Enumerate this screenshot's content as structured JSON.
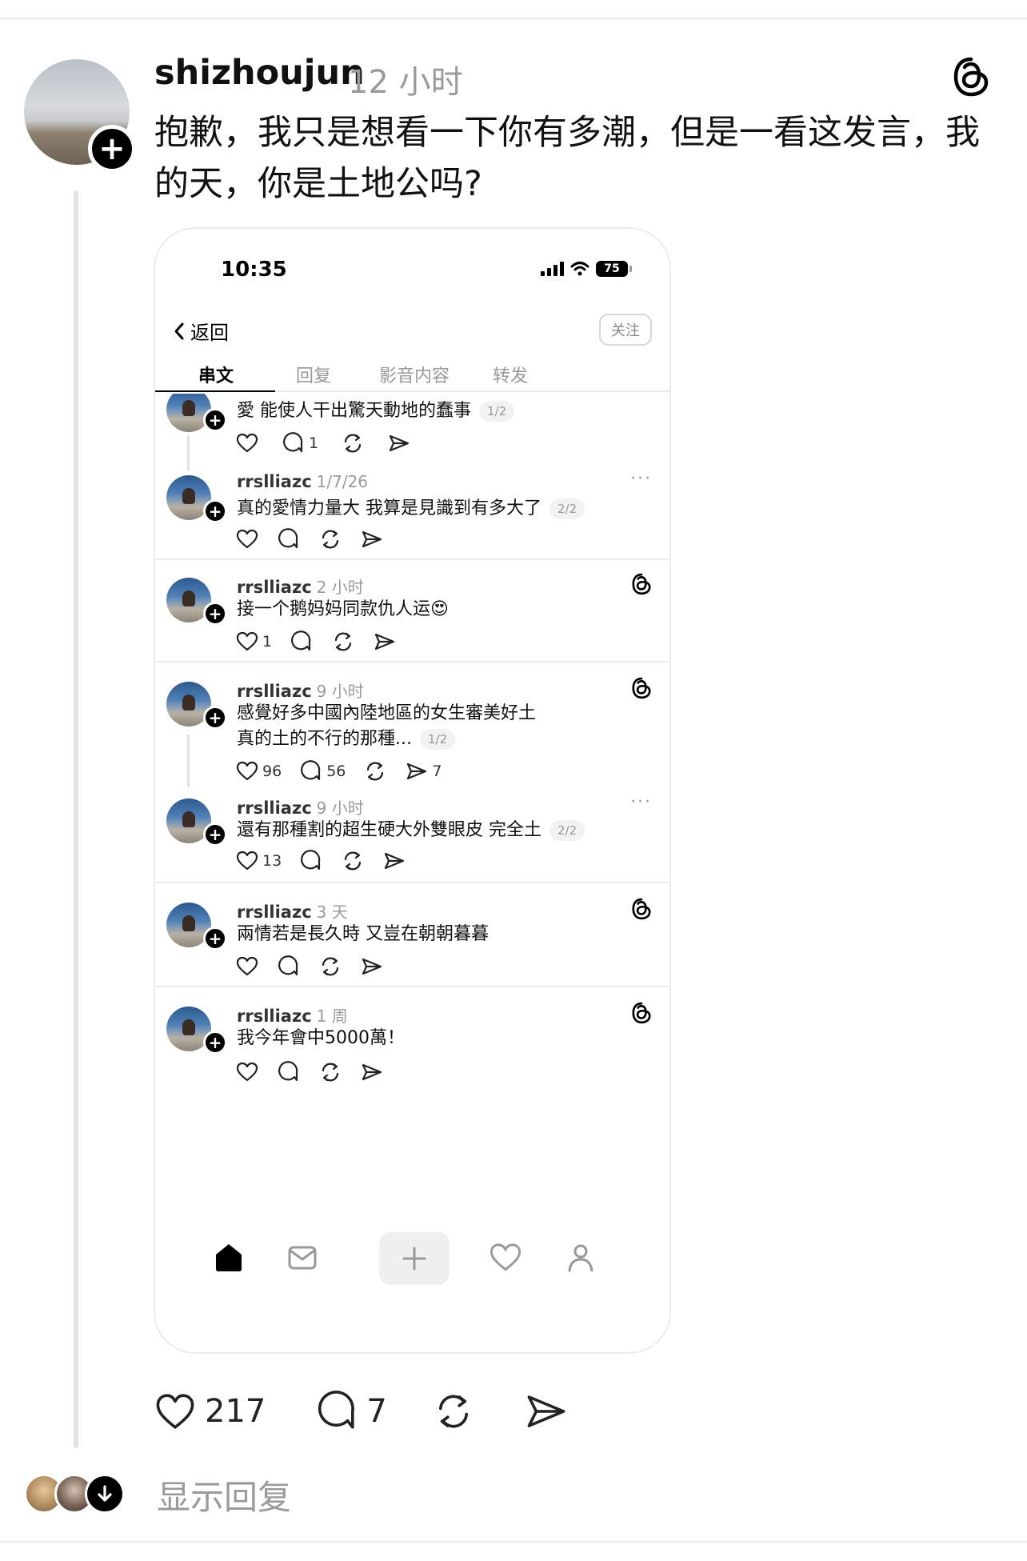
{
  "post": {
    "username": "shizhoujun",
    "timestamp": "12 小时",
    "text": "抱歉，我只是想看一下你有多潮，但是一看这发言，我的天，你是土地公吗?",
    "likes": "217",
    "comments": "7"
  },
  "screenshot": {
    "status_time": "10:35",
    "battery": "75",
    "back_label": "返回",
    "follow_label": "关注",
    "tabs": [
      "串文",
      "回复",
      "影音内容",
      "转发"
    ],
    "posts": [
      {
        "username": "",
        "time": "",
        "text": "愛 能使人干出驚天動地的蠢事",
        "pill": "1/2",
        "likes": "",
        "replies": "1",
        "shares": ""
      },
      {
        "username": "rrslliazc",
        "time": "1/7/26",
        "text": "真的愛情力量大 我算是見識到有多大了",
        "pill": "2/2",
        "likes": "",
        "replies": "",
        "shares": ""
      },
      {
        "username": "rrslliazc",
        "time": "2 小时",
        "text": "接一个鹅妈妈同款仇人运😍",
        "pill": "",
        "likes": "1",
        "replies": "",
        "shares": ""
      },
      {
        "username": "rrslliazc",
        "time": "9 小时",
        "text": "感覺好多中國內陸地區的女生審美好土",
        "text2": "真的土的不行的那種...",
        "pill": "1/2",
        "likes": "96",
        "replies": "56",
        "shares": "7"
      },
      {
        "username": "rrslliazc",
        "time": "9 小时",
        "text": "還有那種割的超生硬大外雙眼皮  完全土",
        "pill": "2/2",
        "likes": "13",
        "replies": "",
        "shares": ""
      },
      {
        "username": "rrslliazc",
        "time": "3 天",
        "text": "兩情若是長久時 又豈在朝朝暮暮",
        "pill": "",
        "likes": "",
        "replies": "",
        "shares": ""
      },
      {
        "username": "rrslliazc",
        "time": "1 周",
        "text": "我今年會中5000萬！",
        "pill": "",
        "likes": "",
        "replies": "",
        "shares": ""
      }
    ]
  },
  "replies": {
    "label": "显示回复"
  },
  "icons": [
    "threads-logo-icon",
    "heart-icon",
    "comment-icon",
    "repost-icon",
    "share-icon",
    "home-icon",
    "inbox-icon",
    "plus-icon",
    "person-icon",
    "chevron-left-icon",
    "more-icon",
    "arrow-down-icon"
  ]
}
